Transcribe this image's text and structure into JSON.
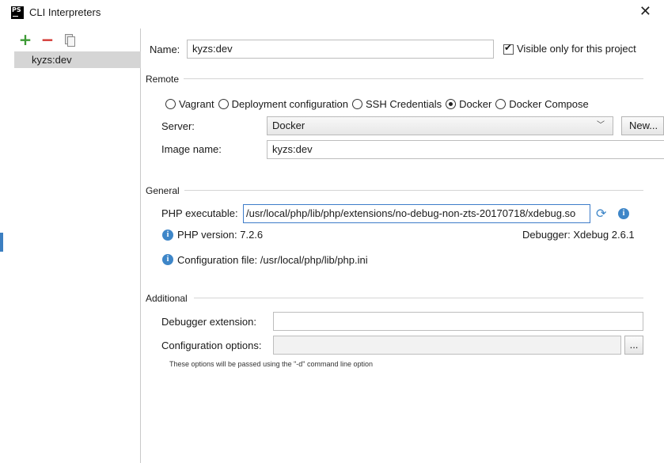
{
  "window": {
    "title": "CLI Interpreters",
    "app_icon": "PS"
  },
  "sidebar": {
    "toolbar": {
      "add": "+",
      "remove": "−"
    },
    "items": [
      {
        "label": "kyzs:dev"
      }
    ]
  },
  "form": {
    "name_label": "Name:",
    "name_value": "kyzs:dev",
    "visible_only_label": "Visible only for this project",
    "visible_only_checked": true,
    "remote": {
      "section_title": "Remote",
      "options": [
        "Vagrant",
        "Deployment configuration",
        "SSH Credentials",
        "Docker",
        "Docker Compose"
      ],
      "selected": "Docker",
      "server_label": "Server:",
      "server_value": "Docker",
      "new_button": "New...",
      "image_label": "Image name:",
      "image_value": "kyzs:dev"
    },
    "general": {
      "section_title": "General",
      "php_exec_label": "PHP executable:",
      "php_exec_value": "/usr/local/php/lib/php/extensions/no-debug-non-zts-20170718/xdebug.so",
      "php_version": "PHP version: 7.2.6",
      "debugger": "Debugger: Xdebug 2.6.1",
      "config_file": "Configuration file: /usr/local/php/lib/php.ini"
    },
    "additional": {
      "section_title": "Additional",
      "debugger_ext_label": "Debugger extension:",
      "debugger_ext_value": "",
      "config_options_label": "Configuration options:",
      "config_options_value": "",
      "browse_button": "...",
      "note": "These options will be passed using the \"-d\" command line option"
    }
  }
}
